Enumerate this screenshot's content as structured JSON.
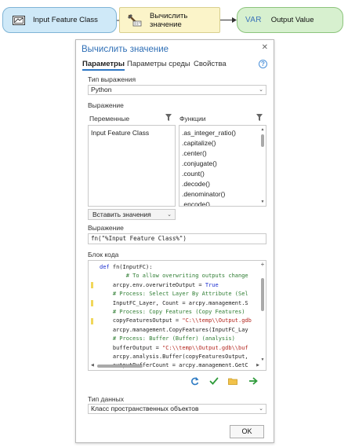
{
  "diagram": {
    "input_node": {
      "label": "Input Feature Class"
    },
    "tool_node": {
      "label": "Вычислить значение"
    },
    "output_node": {
      "tag": "VAR",
      "label": "Output Value"
    }
  },
  "dialog": {
    "title": "Вычислить значение",
    "tabs": [
      {
        "label": "Параметры",
        "active": true
      },
      {
        "label": "Параметры среды",
        "active": false
      },
      {
        "label": "Свойства",
        "active": false
      }
    ],
    "expression_type": {
      "label": "Тип выражения",
      "value": "Python"
    },
    "expression_section_label": "Выражение",
    "variables": {
      "label": "Переменные",
      "items": [
        "Input Feature Class"
      ]
    },
    "functions": {
      "label": "Функции",
      "items": [
        ".as_integer_ratio()",
        ".capitalize()",
        ".center()",
        ".conjugate()",
        ".count()",
        ".decode()",
        ".denominator()",
        ".encode()"
      ]
    },
    "insert_values": {
      "label": "Вставить значения"
    },
    "expression": {
      "label": "Выражение",
      "value": "fn(\"%Input Feature Class%\")"
    },
    "code_block": {
      "label": "Блок кода",
      "lines": [
        {
          "parts": [
            [
              "kw",
              "def "
            ],
            [
              "",
              "fn(InputFC):"
            ]
          ]
        },
        {
          "parts": [
            [
              "cm",
              "        # To allow overwriting outputs change"
            ]
          ]
        },
        {
          "parts": [
            [
              "",
              "    arcpy.env.overwriteOutput = "
            ],
            [
              "kw",
              "True"
            ]
          ]
        },
        {
          "parts": [
            [
              "cm",
              "    # Process: Select Layer By Attribute (Sel"
            ]
          ]
        },
        {
          "parts": [
            [
              "",
              "    InputFC_Layer, Count = arcpy.management.S"
            ]
          ]
        },
        {
          "parts": [
            [
              "cm",
              "    # Process: Copy Features (Copy Features)"
            ]
          ]
        },
        {
          "parts": [
            [
              "",
              "    copyFeaturesOutput = "
            ],
            [
              "st",
              "\"C:\\\\temp\\\\Output.gdb"
            ]
          ]
        },
        {
          "parts": [
            [
              "",
              "    arcpy.management.CopyFeatures(InputFC_Lay"
            ]
          ]
        },
        {
          "parts": [
            [
              "cm",
              "    # Process: Buffer (Buffer) (analysis)"
            ]
          ]
        },
        {
          "parts": [
            [
              "",
              "    bufferOutput = "
            ],
            [
              "st",
              "\"C:\\\\temp\\\\Output.gdb\\\\buf"
            ]
          ]
        },
        {
          "parts": [
            [
              "",
              "    arcpy.analysis.Buffer(copyFeaturesOutput,"
            ]
          ]
        },
        {
          "parts": [
            [
              "",
              "    outputBufferCount = arcpy.management.GetC"
            ]
          ]
        }
      ]
    },
    "data_type": {
      "label": "Тип данных",
      "value": "Класс пространственных объектов"
    },
    "ok_button": {
      "label": "OK"
    }
  },
  "icons": {
    "feature_class": "feature-class-icon",
    "tool": "calculate-value-tool-icon",
    "undo": "undo-icon",
    "verify": "check-icon",
    "open": "folder-icon",
    "export": "arrow-right-icon",
    "filter": "filter-icon",
    "help": "help-icon",
    "close": "close-icon"
  },
  "colors": {
    "title_blue": "#2f6fb6",
    "input_node_fill": "#cfe9f8",
    "tool_node_fill": "#fbf4c9",
    "output_node_fill": "#d7f0cf"
  }
}
